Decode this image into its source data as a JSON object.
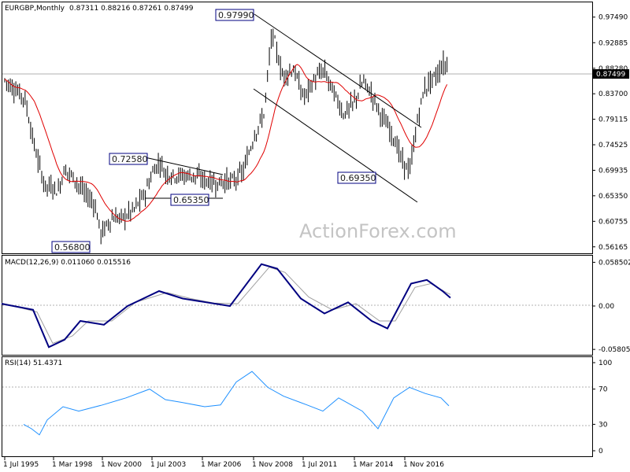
{
  "panels": {
    "price": {
      "title": "EURGBP,Monthly",
      "ohlc_readout": "0.87311 0.88216 0.87261 0.87499",
      "current_price_label": "0.87499",
      "y_ticks": [
        "0.97490",
        "0.92885",
        "0.88280",
        "0.83700",
        "0.79115",
        "0.74525",
        "0.69935",
        "0.65350",
        "0.60755",
        "0.56165"
      ],
      "annotations": [
        "0.97990",
        "0.72580",
        "0.65350",
        "0.69350",
        "0.56800"
      ],
      "watermark": "ActionForex.com"
    },
    "macd": {
      "title": "MACD(12,26,9) 0.011060 0.015516",
      "y_ticks": [
        "0.058502",
        "0.00",
        "-0.058054"
      ]
    },
    "rsi": {
      "title": "RSI(14) 51.4371",
      "y_ticks": [
        "100",
        "70",
        "30",
        "0"
      ]
    }
  },
  "x_ticks": [
    "1 Jul 1995",
    "1 Mar 1998",
    "1 Nov 2000",
    "1 Jul 2003",
    "1 Mar 2006",
    "1 Nov 2008",
    "1 Jul 2011",
    "1 Mar 2014",
    "1 Nov 2016"
  ],
  "colors": {
    "candles": "#000000",
    "ma": "#e00000",
    "channel": "#000000",
    "macd_line": "#000080",
    "macd_signal": "#a0a0a0",
    "rsi_line": "#1e90ff",
    "levels": "#b0b0b0",
    "box_border": "#000080"
  },
  "chart_data": [
    {
      "type": "candlestick",
      "title": "EURGBP,Monthly",
      "x_ticks": [
        "1 Jul 1995",
        "1 Mar 1998",
        "1 Nov 2000",
        "1 Jul 2003",
        "1 Mar 2006",
        "1 Nov 2008",
        "1 Jul 2011",
        "1 Mar 2014",
        "1 Nov 2016"
      ],
      "ylim": [
        0.55,
        1.0
      ],
      "series": [
        {
          "values": [
            {
              "x": "1995-07",
              "close": 0.862
            },
            {
              "x": "1996-01",
              "close": 0.845
            },
            {
              "x": "1996-07",
              "close": 0.83
            },
            {
              "x": "1997-01",
              "close": 0.74
            },
            {
              "x": "1997-07",
              "close": 0.672
            },
            {
              "x": "1998-01",
              "close": 0.668
            },
            {
              "x": "1998-03",
              "close": 0.66
            },
            {
              "x": "1998-07",
              "close": 0.702
            },
            {
              "x": "1999-01",
              "close": 0.685
            },
            {
              "x": "1999-07",
              "close": 0.658
            },
            {
              "x": "2000-01",
              "close": 0.64
            },
            {
              "x": "2000-05",
              "close": 0.585
            },
            {
              "x": "2000-11",
              "close": 0.612
            },
            {
              "x": "2001-07",
              "close": 0.615
            },
            {
              "x": "2002-01",
              "close": 0.63
            },
            {
              "x": "2002-07",
              "close": 0.655
            },
            {
              "x": "2003-01",
              "close": 0.702
            },
            {
              "x": "2003-05",
              "close": 0.715
            },
            {
              "x": "2003-07",
              "close": 0.695
            },
            {
              "x": "2004-01",
              "close": 0.69
            },
            {
              "x": "2004-07",
              "close": 0.69
            },
            {
              "x": "2005-01",
              "close": 0.69
            },
            {
              "x": "2005-07",
              "close": 0.682
            },
            {
              "x": "2006-03",
              "close": 0.675
            },
            {
              "x": "2006-07",
              "close": 0.68
            },
            {
              "x": "2007-01",
              "close": 0.68
            },
            {
              "x": "2007-07",
              "close": 0.7
            },
            {
              "x": "2008-01",
              "close": 0.76
            },
            {
              "x": "2008-07",
              "close": 0.8
            },
            {
              "x": "2008-12",
              "close": 0.95
            },
            {
              "x": "2009-06",
              "close": 0.87
            },
            {
              "x": "2010-01",
              "close": 0.88
            },
            {
              "x": "2010-07",
              "close": 0.83
            },
            {
              "x": "2011-01",
              "close": 0.86
            },
            {
              "x": "2011-07",
              "close": 0.88
            },
            {
              "x": "2012-01",
              "close": 0.84
            },
            {
              "x": "2012-07",
              "close": 0.8
            },
            {
              "x": "2013-01",
              "close": 0.82
            },
            {
              "x": "2013-07",
              "close": 0.86
            },
            {
              "x": "2014-01",
              "close": 0.83
            },
            {
              "x": "2014-07",
              "close": 0.79
            },
            {
              "x": "2015-01",
              "close": 0.76
            },
            {
              "x": "2015-07",
              "close": 0.71
            },
            {
              "x": "2015-11",
              "close": 0.7
            },
            {
              "x": "2016-03",
              "close": 0.78
            },
            {
              "x": "2016-07",
              "close": 0.84
            },
            {
              "x": "2016-11",
              "close": 0.86
            },
            {
              "x": "2017-03",
              "close": 0.87
            },
            {
              "x": "2017-07",
              "close": 0.89
            },
            {
              "x": "2017-11",
              "close": 0.885
            },
            {
              "x": "2018-03",
              "close": 0.875
            },
            {
              "x": "2018-07",
              "close": 0.878
            },
            {
              "x": "2018-10",
              "close": 0.875
            }
          ]
        }
      ],
      "highs_lows": [
        {
          "label": "0.97990",
          "x": "2008-12"
        },
        {
          "label": "0.72580",
          "x": "2003-05"
        },
        {
          "label": "0.65350",
          "x": "2004-07"
        },
        {
          "label": "0.69350",
          "x": "2015-07"
        },
        {
          "label": "0.56800",
          "x": "2000-10"
        }
      ]
    },
    {
      "type": "line",
      "title": "MACD(12,26,9) 0.011060 0.015516",
      "ylim": [
        -0.06,
        0.06
      ],
      "series": [
        {
          "values": [
            [
              0,
              0.003
            ],
            [
              40,
              -0.005
            ],
            [
              60,
              -0.055
            ],
            [
              80,
              -0.045
            ],
            [
              100,
              -0.02
            ],
            [
              130,
              -0.025
            ],
            [
              160,
              0.0
            ],
            [
              200,
              0.02
            ],
            [
              230,
              0.01
            ],
            [
              260,
              0.005
            ],
            [
              290,
              0.0
            ],
            [
              330,
              0.056
            ],
            [
              350,
              0.05
            ],
            [
              380,
              0.01
            ],
            [
              410,
              -0.01
            ],
            [
              440,
              0.005
            ],
            [
              470,
              -0.02
            ],
            [
              490,
              -0.03
            ],
            [
              520,
              0.03
            ],
            [
              540,
              0.035
            ],
            [
              560,
              0.02
            ],
            [
              570,
              0.011
            ]
          ]
        },
        {
          "values": [
            [
              0,
              0.004
            ],
            [
              45,
              -0.008
            ],
            [
              65,
              -0.05
            ],
            [
              90,
              -0.04
            ],
            [
              110,
              -0.02
            ],
            [
              140,
              -0.02
            ],
            [
              170,
              0.005
            ],
            [
              210,
              0.018
            ],
            [
              240,
              0.01
            ],
            [
              270,
              0.004
            ],
            [
              300,
              0.003
            ],
            [
              340,
              0.052
            ],
            [
              360,
              0.045
            ],
            [
              390,
              0.012
            ],
            [
              420,
              -0.005
            ],
            [
              450,
              0.003
            ],
            [
              480,
              -0.02
            ],
            [
              500,
              -0.02
            ],
            [
              525,
              0.025
            ],
            [
              545,
              0.03
            ],
            [
              565,
              0.018
            ],
            [
              570,
              0.0155
            ]
          ]
        }
      ]
    },
    {
      "type": "line",
      "title": "RSI(14) 51.4371",
      "ylim": [
        0,
        100
      ],
      "series": [
        {
          "values": [
            [
              30,
              30
            ],
            [
              40,
              25
            ],
            [
              50,
              18
            ],
            [
              60,
              35
            ],
            [
              80,
              50
            ],
            [
              100,
              45
            ],
            [
              130,
              52
            ],
            [
              160,
              60
            ],
            [
              190,
              70
            ],
            [
              210,
              58
            ],
            [
              230,
              55
            ],
            [
              260,
              50
            ],
            [
              280,
              52
            ],
            [
              300,
              78
            ],
            [
              320,
              90
            ],
            [
              340,
              72
            ],
            [
              360,
              62
            ],
            [
              390,
              52
            ],
            [
              410,
              45
            ],
            [
              430,
              60
            ],
            [
              460,
              45
            ],
            [
              480,
              25
            ],
            [
              500,
              60
            ],
            [
              520,
              72
            ],
            [
              540,
              65
            ],
            [
              560,
              60
            ],
            [
              570,
              51
            ]
          ]
        }
      ]
    }
  ]
}
